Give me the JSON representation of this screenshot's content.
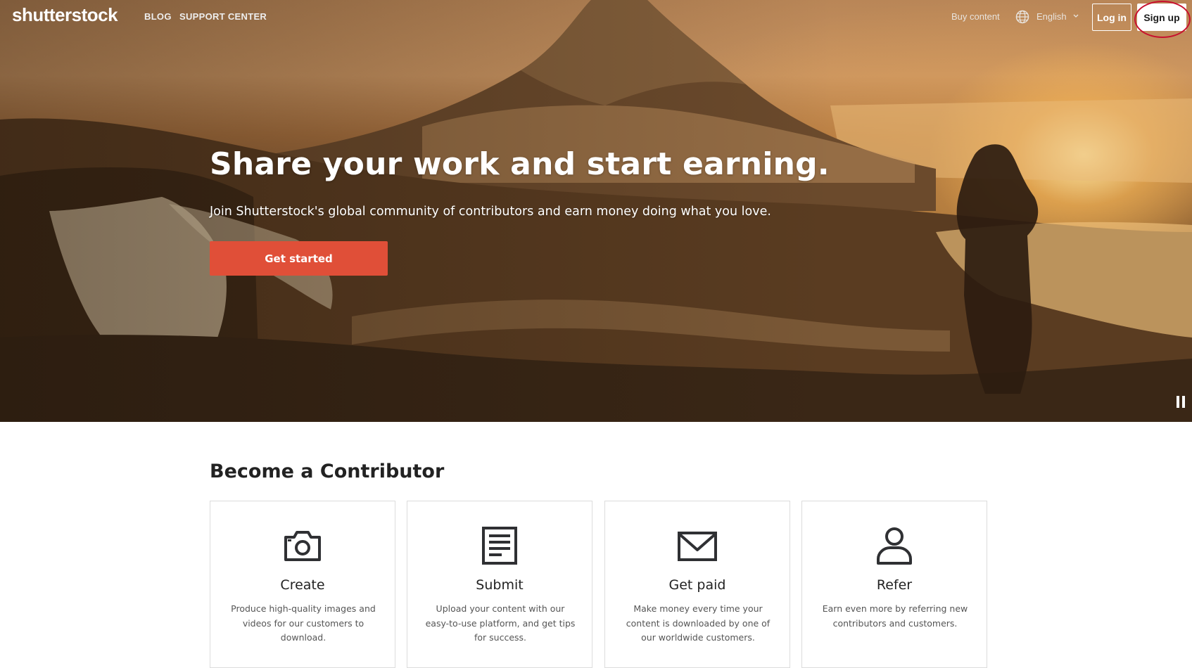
{
  "nav": {
    "logo": "shutterstock",
    "links": [
      "BLOG",
      "SUPPORT CENTER"
    ],
    "buy_content": "Buy content",
    "language": "English",
    "login_label": "Log in",
    "signup_label": "Sign up"
  },
  "hero": {
    "title": "Share your work and start earning.",
    "subtitle": "Join Shutterstock's global community of contributors and earn money doing what you love.",
    "cta_label": "Get started"
  },
  "section": {
    "title": "Become a Contributor",
    "cards": [
      {
        "icon": "camera-icon",
        "title": "Create",
        "desc": "Produce high-quality images and videos for our customers to download."
      },
      {
        "icon": "document-icon",
        "title": "Submit",
        "desc": "Upload your content with our easy-to-use platform, and get tips for success."
      },
      {
        "icon": "envelope-icon",
        "title": "Get paid",
        "desc": "Make money every time your content is downloaded by one of our worldwide customers."
      },
      {
        "icon": "person-icon",
        "title": "Refer",
        "desc": "Earn even more by referring new contributors and customers."
      }
    ]
  },
  "colors": {
    "cta": "#e04f38",
    "annotation": "#c8102e"
  }
}
